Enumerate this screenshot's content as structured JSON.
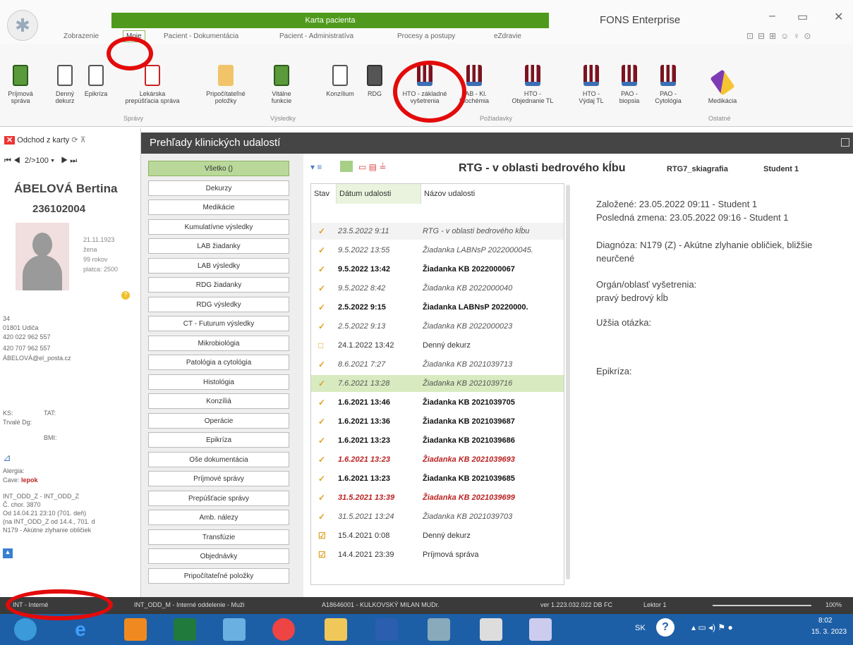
{
  "app": {
    "context_title": "Karta pacienta",
    "app_title": "FONS Enterprise",
    "tabs": [
      "Zobrazenie",
      "Moje",
      "Pacient - Dokumentácia",
      "Pacient - Administratíva",
      "Procesy a postupy",
      "eZdravie"
    ],
    "window_buttons": [
      "–",
      "▭",
      "✕"
    ]
  },
  "ribbon": {
    "spravy": [
      "Príjmová správa",
      "Denný dekurz",
      "Epikríza",
      "Lekárska prepúšťacia správa",
      "Pripočítateľné položky"
    ],
    "vysledky": [
      "Vitálne funkcie"
    ],
    "poziadavky": [
      "Konzílium",
      "RDG",
      "HTO - základné vyšetrenia",
      "LAB - Kl. Biochémia",
      "HTO - Objednanie TL",
      "HTO - Výdaj TL",
      "PAO - biopsia",
      "PAO - Cytológia"
    ],
    "ostatne": [
      "Medikácia"
    ],
    "groups": [
      "Správy",
      "Výsledky",
      "Požiadavky",
      "Ostatné"
    ]
  },
  "patient": {
    "close_label": "Odchod z karty",
    "nav": "2/>100",
    "name": "ÁBELOVÁ Bertina",
    "id": "236102004",
    "birth": "21.11.1923",
    "sex": "žena",
    "age": "99 rokov",
    "weight": "platca: 2500",
    "address_no": "34",
    "city": "01801 Udiča",
    "phone1": "420 022 962 557",
    "phone2": "420 707 962 557",
    "email": "ÁBELOVÁ@el_posta.cz",
    "ks": "KS:",
    "tat": "TAT:",
    "trvale": "Trvalé Dg:",
    "bmi": "BMI:",
    "alergia": "Alergia:",
    "cave": "Cave:",
    "cave_value": "lepok",
    "hosp1": "INT_ODD_Z - INT_ODD_Z",
    "hosp2": "Č. chor. 3870",
    "hosp3": "Od 14.04.21 23:10 (701. deň)",
    "hosp4": "(na INT_ODD_Z od 14.4., 701. d",
    "hosp5": "N179 - Akútne zlyhanie obličiek"
  },
  "main": {
    "title": "Prehľady klinických udalostí",
    "categories": [
      "Všetko ()",
      "Dekurzy",
      "Medikácie",
      "Kumulatívne výsledky",
      "LAB žiadanky",
      "LAB výsledky",
      "RDG žiadanky",
      "RDG výsledky",
      "CT - Futurum výsledky",
      "Mikrobiológia",
      "Patológia a cytológia",
      "Histológia",
      "Konzíliá",
      "Operácie",
      "Epikríza",
      "Oše dokumentácia",
      "Príjmové správy",
      "Prepúšťacie správy",
      "Amb. nálezy",
      "Transfúzie",
      "Objednávky",
      "Pripočítateľné položky"
    ],
    "list_headers": [
      "Stav",
      "Dátum udalosti",
      "Názov udalosti"
    ],
    "rows": [
      {
        "date": "23.5.2022 9:11",
        "name": "RTG - v oblasti bedrového kĺbu",
        "style": "it",
        "icon": "✓"
      },
      {
        "date": "9.5.2022 13:55",
        "name": "Žiadanka LABNsP 2022000045.",
        "style": "it",
        "icon": "✓"
      },
      {
        "date": "9.5.2022 13:42",
        "name": "Žiadanka KB 2022000067",
        "style": "bold",
        "icon": "✓"
      },
      {
        "date": "9.5.2022 8:42",
        "name": "Žiadanka KB 2022000040",
        "style": "it",
        "icon": "✓"
      },
      {
        "date": "2.5.2022 9:15",
        "name": "Žiadanka LABNsP 20220000.",
        "style": "bold",
        "icon": "✓"
      },
      {
        "date": "2.5.2022 9:13",
        "name": "Žiadanka KB 2022000023",
        "style": "it",
        "icon": "✓"
      },
      {
        "date": "24.1.2022 13:42",
        "name": "Denný dekurz",
        "style": "",
        "icon": "□"
      },
      {
        "date": "8.6.2021 7:27",
        "name": "Žiadanka KB 2021039713",
        "style": "it",
        "icon": "✓"
      },
      {
        "date": "7.6.2021 13:28",
        "name": "Žiadanka KB 2021039716",
        "style": "it sel",
        "icon": "✓"
      },
      {
        "date": "1.6.2021 13:46",
        "name": "Žiadanka KB 2021039705",
        "style": "bold",
        "icon": "✓"
      },
      {
        "date": "1.6.2021 13:36",
        "name": "Žiadanka KB 2021039687",
        "style": "bold",
        "icon": "✓"
      },
      {
        "date": "1.6.2021 13:23",
        "name": "Žiadanka KB 2021039686",
        "style": "bold",
        "icon": "✓"
      },
      {
        "date": "1.6.2021 13:23",
        "name": "Žiadanka KB 2021039693",
        "style": "red",
        "icon": "✓"
      },
      {
        "date": "1.6.2021 13:23",
        "name": "Žiadanka KB 2021039685",
        "style": "bold",
        "icon": "✓"
      },
      {
        "date": "31.5.2021 13:39",
        "name": "Žiadanka KB 2021039699",
        "style": "red",
        "icon": "✓"
      },
      {
        "date": "31.5.2021 13:24",
        "name": "Žiadanka KB 2021039703",
        "style": "it",
        "icon": "✓"
      },
      {
        "date": "15.4.2021 0:08",
        "name": "Denný dekurz",
        "style": "",
        "icon": "☑"
      },
      {
        "date": "14.4.2021 23:39",
        "name": "Príjmová správa",
        "style": "",
        "icon": "☑"
      }
    ],
    "detail_title": "RTG - v oblasti bedrového kĺbu",
    "detail_code": "RTG7_skiagrafia",
    "detail_user": "Student 1",
    "detail_created": "Založené: 23.05.2022 09:11 - Student 1",
    "detail_changed": "Posledná zmena: 23.05.2022 09:16 - Student 1",
    "detail_diag": "Diagnóza: N179 (Z) - Akútne zlyhanie obličiek, bližšie neurčené",
    "detail_organ_label": "Orgán/oblasť vyšetrenia:",
    "detail_organ": "pravý bedrový kĺb",
    "detail_question": "Užšia otázka:",
    "detail_epi": "Epikríza:"
  },
  "status": {
    "dept": "INT - Interné",
    "ward": "INT_ODD_M - Interné oddelenie - Muži",
    "doctor": "A18646001 - KULKOVSKÝ MILAN MUDr.",
    "version": "ver 1.223.032.022 DB FC",
    "user": "Lektor 1",
    "zoom": "100%"
  },
  "taskbar": {
    "lang": "SK",
    "time": "8:02",
    "date": "15. 3. 2023"
  }
}
